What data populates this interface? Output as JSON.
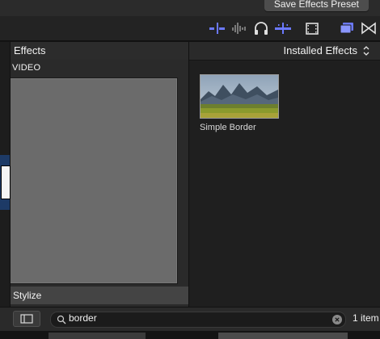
{
  "topbar": {
    "save_preset_label": "Save Effects Preset"
  },
  "toolbar": {
    "icons": [
      "audio-meter-icon",
      "waveform-icon",
      "headphones-icon",
      "skimming-icon",
      "filmstrip-icon",
      "browser-icon",
      "transitions-icon"
    ],
    "accent": "#6b79ff"
  },
  "left_panel": {
    "title": "Effects",
    "section_label": "VIDEO",
    "selected_category": "Stylize"
  },
  "right_panel": {
    "source_label": "Installed Effects",
    "effects": [
      {
        "name": "Simple Border"
      }
    ]
  },
  "bottom_bar": {
    "search": {
      "value": "border"
    },
    "count_label": "1 item"
  },
  "colors": {
    "background": "#1e1e1e",
    "panel": "#2a2a2a",
    "selection": "#444444",
    "accent_blue": "#6b79ff"
  }
}
